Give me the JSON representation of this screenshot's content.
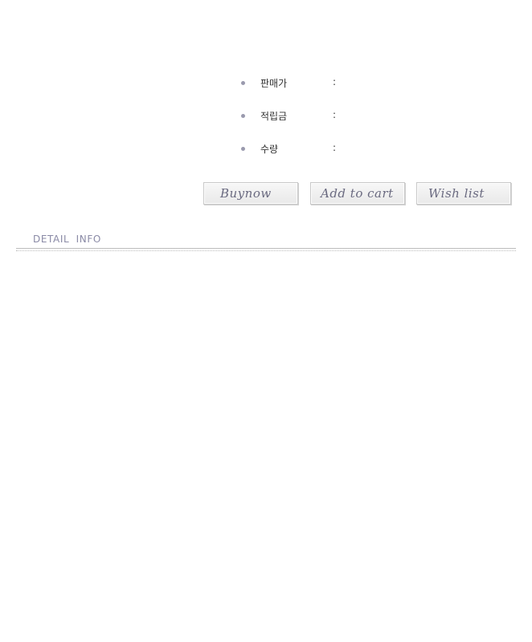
{
  "product_info": {
    "rows": [
      {
        "label": "판매가",
        "separator": ":"
      },
      {
        "label": "적립금",
        "separator": ":"
      },
      {
        "label": "수량",
        "separator": ":"
      }
    ]
  },
  "actions": {
    "buy_now_label": "Buynow",
    "add_to_cart_label": "Add to cart",
    "wish_list_label": "Wish list"
  },
  "detail": {
    "title": "DETAIL INFO"
  }
}
